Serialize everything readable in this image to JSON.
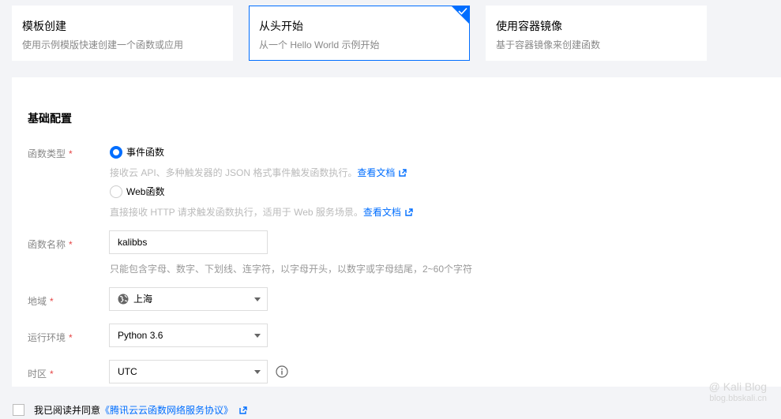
{
  "cards": [
    {
      "title": "模板创建",
      "desc": "使用示例模版快速创建一个函数或应用"
    },
    {
      "title": "从头开始",
      "desc": "从一个 Hello World 示例开始"
    },
    {
      "title": "使用容器镜像",
      "desc": "基于容器镜像来创建函数"
    }
  ],
  "section_title": "基础配置",
  "func_type": {
    "label": "函数类型",
    "required_mark": "*",
    "options": [
      {
        "label": "事件函数",
        "help": "接收云 API、多种触发器的 JSON 格式事件触发函数执行。",
        "link": "查看文档",
        "selected": true
      },
      {
        "label": "Web函数",
        "help": "直接接收 HTTP 请求触发函数执行，适用于 Web 服务场景。",
        "link": "查看文档",
        "selected": false
      }
    ]
  },
  "func_name": {
    "label": "函数名称",
    "required_mark": "*",
    "value": "kalibbs",
    "help": "只能包含字母、数字、下划线、连字符，以字母开头，以数字或字母结尾，2~60个字符"
  },
  "region": {
    "label": "地域",
    "required_mark": "*",
    "value": "上海"
  },
  "runtime": {
    "label": "运行环境",
    "required_mark": "*",
    "value": "Python 3.6"
  },
  "timezone": {
    "label": "时区",
    "required_mark": "*",
    "value": "UTC"
  },
  "agreement": {
    "text": "我已阅读并同意",
    "link": "《腾讯云云函数网络服务协议》"
  },
  "watermark": {
    "line1": "@ Kali Blog",
    "line2": "blog.bbskali.cn"
  },
  "colors": {
    "accent": "#006eff",
    "required": "#e54545"
  }
}
